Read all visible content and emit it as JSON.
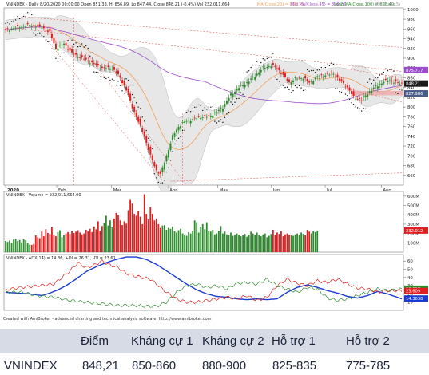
{
  "chart_data": [
    {
      "type": "candlestick",
      "title": "VNINDEX - Daily 8/20/2020 00:00:00 Open 851.33, Hi 856.89, Lo 847.44, Close 848.21 (-0.4%) Vol 232,011,664",
      "ma_labels": [
        "MA(Close,20) = 830.73,",
        "Mid MA(Close,45) = 846.76,",
        "Long MA(Close,100) = 828.40,",
        "ZIG(Close,5)"
      ],
      "x_ticks": [
        "2020",
        "Feb",
        "Mar",
        "Apr",
        "May",
        "Jun",
        "Jul",
        "Aug"
      ],
      "y_ticks": [
        660,
        680,
        700,
        720,
        740,
        760,
        780,
        800,
        820,
        840,
        860,
        880,
        900,
        920,
        940,
        960,
        980,
        1000
      ],
      "ylim": [
        640,
        1003
      ],
      "markers": [
        "875.717",
        "848.21",
        "827.986"
      ],
      "close_path": [
        [
          0,
          958
        ],
        [
          6,
          964
        ],
        [
          12,
          968
        ],
        [
          18,
          964
        ],
        [
          22,
          952
        ],
        [
          25,
          920
        ],
        [
          29,
          930
        ],
        [
          33,
          910
        ],
        [
          38,
          900
        ],
        [
          43,
          890
        ],
        [
          48,
          880
        ],
        [
          53,
          880
        ],
        [
          57,
          860
        ],
        [
          60,
          835
        ],
        [
          63,
          800
        ],
        [
          66,
          770
        ],
        [
          69,
          740
        ],
        [
          72,
          700
        ],
        [
          75,
          670
        ],
        [
          77,
          662
        ],
        [
          80,
          700
        ],
        [
          83,
          740
        ],
        [
          86,
          760
        ],
        [
          89,
          770
        ],
        [
          93,
          775
        ],
        [
          97,
          780
        ],
        [
          101,
          780
        ],
        [
          105,
          790
        ],
        [
          108,
          800
        ],
        [
          112,
          825
        ],
        [
          116,
          840
        ],
        [
          120,
          850
        ],
        [
          124,
          864
        ],
        [
          128,
          880
        ],
        [
          132,
          885
        ],
        [
          135,
          880
        ],
        [
          138,
          865
        ],
        [
          141,
          850
        ],
        [
          144,
          858
        ],
        [
          148,
          860
        ],
        [
          151,
          850
        ],
        [
          155,
          862
        ],
        [
          159,
          866
        ],
        [
          163,
          868
        ],
        [
          166,
          855
        ],
        [
          170,
          840
        ],
        [
          173,
          820
        ],
        [
          177,
          815
        ],
        [
          180,
          828
        ],
        [
          184,
          842
        ],
        [
          188,
          852
        ],
        [
          191,
          855
        ],
        [
          194,
          850
        ],
        [
          197,
          848
        ]
      ]
    },
    {
      "type": "bar",
      "title": "VNINDEX - Volume = 232,011,664.00",
      "y_ticks": [
        "100M",
        "200M",
        "300M",
        "400M",
        "500M",
        "600M"
      ],
      "ylim": [
        0,
        650
      ],
      "marker": "232.012",
      "values": [
        120,
        110,
        125,
        100,
        135,
        140,
        118,
        130,
        105,
        140,
        128,
        95,
        80,
        78,
        88,
        180,
        160,
        150,
        220,
        170,
        245,
        205,
        195,
        265,
        185,
        170,
        215,
        235,
        160,
        185,
        200,
        215,
        195,
        230,
        205,
        220,
        235,
        210,
        190,
        200,
        240,
        225,
        250,
        215,
        275,
        245,
        330,
        230,
        280,
        310,
        390,
        285,
        340,
        265,
        360,
        420,
        400,
        340,
        290,
        330,
        305,
        450,
        560,
        520,
        410,
        390,
        440,
        380,
        300,
        620,
        410,
        350,
        480,
        410,
        340,
        360,
        300,
        260,
        285,
        290,
        240,
        260,
        250,
        275,
        225,
        210,
        235,
        250,
        200,
        180,
        175,
        215,
        200,
        230,
        340,
        320,
        210,
        270,
        300,
        245,
        320,
        230,
        220,
        240,
        190,
        200,
        230,
        280,
        200,
        220,
        190,
        180,
        210,
        175,
        190,
        200,
        185,
        170,
        180,
        195,
        165,
        185,
        220,
        200,
        180,
        210,
        185,
        170,
        190,
        200,
        160,
        175,
        195,
        240,
        180,
        210,
        195,
        225,
        170,
        190,
        200,
        185,
        180,
        175,
        190,
        200,
        185,
        210,
        195,
        180,
        240,
        220,
        200,
        225,
        215,
        232
      ]
    },
    {
      "type": "line",
      "title": "VNINDEX - ADX(14) = 14.36, +DI = 26.31, -DI = 23.61",
      "y_ticks": [
        10,
        20,
        30,
        40,
        50,
        60
      ],
      "ylim": [
        0,
        68
      ],
      "markers": [
        "26.307",
        "23.609",
        "14.3638"
      ],
      "series": [
        {
          "name": "ADX(14)",
          "values": [
            [
              0,
              22
            ],
            [
              6,
              21
            ],
            [
              12,
              20
            ],
            [
              18,
              18
            ],
            [
              22,
              21
            ],
            [
              26,
              25
            ],
            [
              30,
              30
            ],
            [
              35,
              38
            ],
            [
              40,
              47
            ],
            [
              45,
              53
            ],
            [
              50,
              58
            ],
            [
              55,
              62
            ],
            [
              60,
              65
            ],
            [
              65,
              65
            ],
            [
              70,
              62
            ],
            [
              75,
              56
            ],
            [
              80,
              48
            ],
            [
              85,
              40
            ],
            [
              90,
              32
            ],
            [
              95,
              25
            ],
            [
              100,
              20
            ],
            [
              105,
              17
            ],
            [
              110,
              16
            ],
            [
              115,
              14
            ],
            [
              120,
              13
            ],
            [
              125,
              14
            ],
            [
              130,
              13
            ],
            [
              135,
              14
            ],
            [
              140,
              22
            ],
            [
              145,
              28
            ],
            [
              150,
              31
            ],
            [
              155,
              28
            ],
            [
              160,
              24
            ],
            [
              165,
              21
            ],
            [
              170,
              17
            ],
            [
              175,
              15
            ],
            [
              180,
              18
            ],
            [
              185,
              23
            ],
            [
              190,
              20
            ],
            [
              197,
              14
            ]
          ]
        },
        {
          "name": "+DI",
          "values": [
            [
              0,
              22
            ],
            [
              8,
              22
            ],
            [
              16,
              18
            ],
            [
              24,
              16
            ],
            [
              32,
              12
            ],
            [
              40,
              10
            ],
            [
              48,
              8
            ],
            [
              56,
              6
            ],
            [
              64,
              6
            ],
            [
              70,
              5
            ],
            [
              75,
              5
            ],
            [
              80,
              10
            ],
            [
              85,
              22
            ],
            [
              90,
              30
            ],
            [
              95,
              32
            ],
            [
              100,
              28
            ],
            [
              105,
              30
            ],
            [
              110,
              26
            ],
            [
              115,
              33
            ],
            [
              120,
              34
            ],
            [
              125,
              32
            ],
            [
              130,
              38
            ],
            [
              135,
              30
            ],
            [
              140,
              26
            ],
            [
              145,
              22
            ],
            [
              150,
              28
            ],
            [
              155,
              26
            ],
            [
              160,
              15
            ],
            [
              165,
              12
            ],
            [
              170,
              14
            ],
            [
              175,
              18
            ],
            [
              180,
              22
            ],
            [
              185,
              26
            ],
            [
              190,
              24
            ],
            [
              197,
              26
            ]
          ]
        },
        {
          "name": "-DI",
          "values": [
            [
              0,
              25
            ],
            [
              8,
              28
            ],
            [
              16,
              30
            ],
            [
              24,
              32
            ],
            [
              28,
              40
            ],
            [
              32,
              48
            ],
            [
              36,
              58
            ],
            [
              40,
              52
            ],
            [
              44,
              55
            ],
            [
              48,
              60
            ],
            [
              52,
              55
            ],
            [
              56,
              52
            ],
            [
              60,
              45
            ],
            [
              64,
              42
            ],
            [
              68,
              40
            ],
            [
              72,
              38
            ],
            [
              76,
              30
            ],
            [
              80,
              22
            ],
            [
              85,
              14
            ],
            [
              90,
              10
            ],
            [
              95,
              10
            ],
            [
              100,
              12
            ],
            [
              105,
              14
            ],
            [
              110,
              16
            ],
            [
              115,
              14
            ],
            [
              120,
              18
            ],
            [
              125,
              12
            ],
            [
              130,
              16
            ],
            [
              135,
              30
            ],
            [
              140,
              38
            ],
            [
              145,
              33
            ],
            [
              150,
              30
            ],
            [
              155,
              36
            ],
            [
              160,
              34
            ],
            [
              165,
              38
            ],
            [
              170,
              32
            ],
            [
              175,
              27
            ],
            [
              180,
              26
            ],
            [
              185,
              22
            ],
            [
              190,
              24
            ],
            [
              197,
              24
            ]
          ]
        }
      ]
    }
  ],
  "footer": "Created with AmiBroker - advanced charting and technical analysis software. http://www.amibroker.com",
  "table": {
    "headers": [
      "",
      "Điểm",
      "Kháng cự 1",
      "Kháng cự 2",
      "Hỗ trợ 1",
      "Hỗ trợ 2"
    ],
    "row": [
      "VNINDEX",
      "848,21",
      "850-860",
      "880-900",
      "825-835",
      "775-785"
    ]
  },
  "colors": {
    "up": "#2e8b2e",
    "down": "#e02020",
    "adx": "#1a3bd1",
    "plus_di": "#2e8b2e",
    "minus_di": "#e02020",
    "ma_long": "#9b4ccf",
    "ma_mid": "#f2a15a",
    "band": "#d4d4d4",
    "table_header": "#d7dbe6"
  }
}
